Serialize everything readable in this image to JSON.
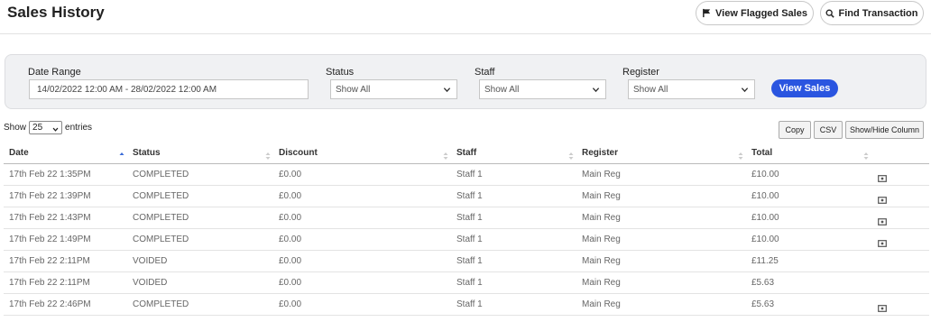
{
  "header": {
    "title": "Sales History",
    "flagged_label": "View Flagged Sales",
    "find_label": "Find Transaction"
  },
  "filters": {
    "date_range_label": "Date Range",
    "date_range_value": "14/02/2022 12:00 AM - 28/02/2022 12:00 AM",
    "status_label": "Status",
    "status_value": "Show All",
    "staff_label": "Staff",
    "staff_value": "Show All",
    "register_label": "Register",
    "register_value": "Show All",
    "view_sales_label": "View Sales"
  },
  "table_controls": {
    "show_label": "Show",
    "entries_value": "25",
    "entries_label": "entries",
    "copy_label": "Copy",
    "csv_label": "CSV",
    "show_hide_label": "Show/Hide Column"
  },
  "table": {
    "columns": [
      "Date",
      "Status",
      "Discount",
      "Staff",
      "Register",
      "Total"
    ],
    "rows": [
      {
        "date": "17th Feb 22 1:35PM",
        "status": "COMPLETED",
        "discount": "£0.00",
        "staff": "Staff 1",
        "register": "Main Reg",
        "total": "£10.00",
        "receipt": true
      },
      {
        "date": "17th Feb 22 1:39PM",
        "status": "COMPLETED",
        "discount": "£0.00",
        "staff": "Staff 1",
        "register": "Main Reg",
        "total": "£10.00",
        "receipt": true
      },
      {
        "date": "17th Feb 22 1:43PM",
        "status": "COMPLETED",
        "discount": "£0.00",
        "staff": "Staff 1",
        "register": "Main Reg",
        "total": "£10.00",
        "receipt": true
      },
      {
        "date": "17th Feb 22 1:49PM",
        "status": "COMPLETED",
        "discount": "£0.00",
        "staff": "Staff 1",
        "register": "Main Reg",
        "total": "£10.00",
        "receipt": true
      },
      {
        "date": "17th Feb 22 2:11PM",
        "status": "VOIDED",
        "discount": "£0.00",
        "staff": "Staff 1",
        "register": "Main Reg",
        "total": "£11.25",
        "receipt": false
      },
      {
        "date": "17th Feb 22 2:11PM",
        "status": "VOIDED",
        "discount": "£0.00",
        "staff": "Staff 1",
        "register": "Main Reg",
        "total": "£5.63",
        "receipt": false
      },
      {
        "date": "17th Feb 22 2:46PM",
        "status": "COMPLETED",
        "discount": "£0.00",
        "staff": "Staff 1",
        "register": "Main Reg",
        "total": "£5.63",
        "receipt": true
      }
    ]
  },
  "icons": {
    "flag": "flag-icon",
    "search": "search-icon",
    "chevron": "chevron-down-icon",
    "sort_asc": "sort-ascending-icon",
    "sort_both": "sort-icon",
    "receipt": "receipt-icon"
  },
  "colors": {
    "accent": "#2a55e0",
    "panel_bg": "#f0f1f3",
    "text_muted": "#666666"
  }
}
